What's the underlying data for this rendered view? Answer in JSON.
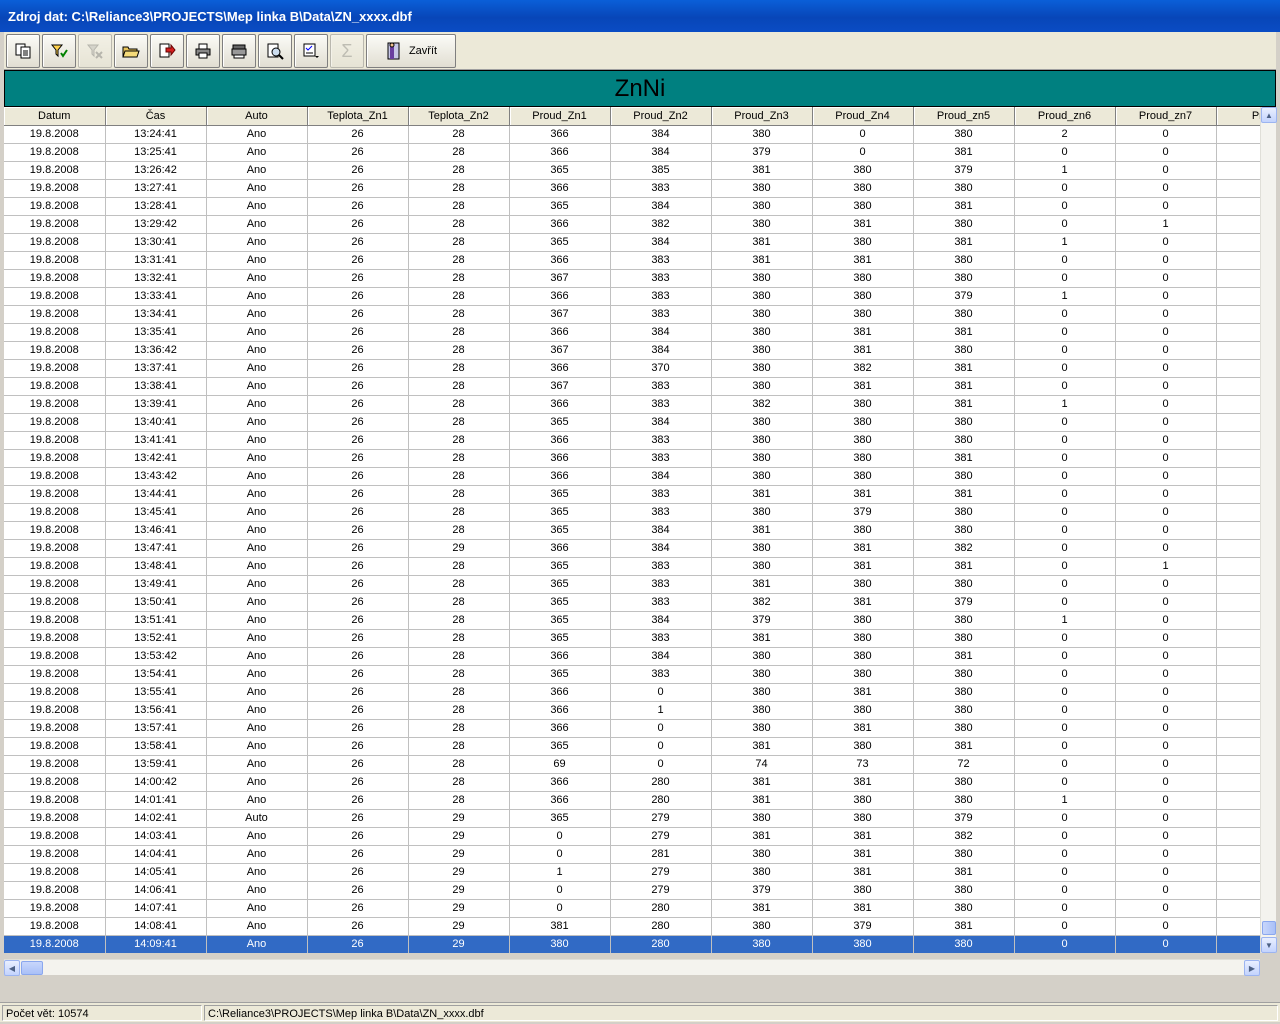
{
  "window": {
    "title": "Zdroj dat: C:\\Reliance3\\PROJECTS\\Mep linka B\\Data\\ZN_xxxx.dbf"
  },
  "toolbar": {
    "close_label": "Zavřít"
  },
  "banner": {
    "title": "ZnNi"
  },
  "table": {
    "columns": [
      "Datum",
      "Čas",
      "Auto",
      "Teplota_Zn1",
      "Teplota_Zn2",
      "Proud_Zn1",
      "Proud_Zn2",
      "Proud_Zn3",
      "Proud_Zn4",
      "Proud_zn5",
      "Proud_zn6",
      "Proud_zn7",
      "Proud"
    ],
    "selected_row": 45,
    "rows": [
      [
        "19.8.2008",
        "13:24:41",
        "Ano",
        "26",
        "28",
        "366",
        "384",
        "380",
        "0",
        "380",
        "2",
        "0",
        ""
      ],
      [
        "19.8.2008",
        "13:25:41",
        "Ano",
        "26",
        "28",
        "366",
        "384",
        "379",
        "0",
        "381",
        "0",
        "0",
        ""
      ],
      [
        "19.8.2008",
        "13:26:42",
        "Ano",
        "26",
        "28",
        "365",
        "385",
        "381",
        "380",
        "379",
        "1",
        "0",
        ""
      ],
      [
        "19.8.2008",
        "13:27:41",
        "Ano",
        "26",
        "28",
        "366",
        "383",
        "380",
        "380",
        "380",
        "0",
        "0",
        ""
      ],
      [
        "19.8.2008",
        "13:28:41",
        "Ano",
        "26",
        "28",
        "365",
        "384",
        "380",
        "380",
        "381",
        "0",
        "0",
        ""
      ],
      [
        "19.8.2008",
        "13:29:42",
        "Ano",
        "26",
        "28",
        "366",
        "382",
        "380",
        "381",
        "380",
        "0",
        "1",
        ""
      ],
      [
        "19.8.2008",
        "13:30:41",
        "Ano",
        "26",
        "28",
        "365",
        "384",
        "381",
        "380",
        "381",
        "1",
        "0",
        ""
      ],
      [
        "19.8.2008",
        "13:31:41",
        "Ano",
        "26",
        "28",
        "366",
        "383",
        "381",
        "381",
        "380",
        "0",
        "0",
        ""
      ],
      [
        "19.8.2008",
        "13:32:41",
        "Ano",
        "26",
        "28",
        "367",
        "383",
        "380",
        "380",
        "380",
        "0",
        "0",
        ""
      ],
      [
        "19.8.2008",
        "13:33:41",
        "Ano",
        "26",
        "28",
        "366",
        "383",
        "380",
        "380",
        "379",
        "1",
        "0",
        ""
      ],
      [
        "19.8.2008",
        "13:34:41",
        "Ano",
        "26",
        "28",
        "367",
        "383",
        "380",
        "380",
        "380",
        "0",
        "0",
        ""
      ],
      [
        "19.8.2008",
        "13:35:41",
        "Ano",
        "26",
        "28",
        "366",
        "384",
        "380",
        "381",
        "381",
        "0",
        "0",
        ""
      ],
      [
        "19.8.2008",
        "13:36:42",
        "Ano",
        "26",
        "28",
        "367",
        "384",
        "380",
        "381",
        "380",
        "0",
        "0",
        ""
      ],
      [
        "19.8.2008",
        "13:37:41",
        "Ano",
        "26",
        "28",
        "366",
        "370",
        "380",
        "382",
        "381",
        "0",
        "0",
        ""
      ],
      [
        "19.8.2008",
        "13:38:41",
        "Ano",
        "26",
        "28",
        "367",
        "383",
        "380",
        "381",
        "381",
        "0",
        "0",
        ""
      ],
      [
        "19.8.2008",
        "13:39:41",
        "Ano",
        "26",
        "28",
        "366",
        "383",
        "382",
        "380",
        "381",
        "1",
        "0",
        ""
      ],
      [
        "19.8.2008",
        "13:40:41",
        "Ano",
        "26",
        "28",
        "365",
        "384",
        "380",
        "380",
        "380",
        "0",
        "0",
        ""
      ],
      [
        "19.8.2008",
        "13:41:41",
        "Ano",
        "26",
        "28",
        "366",
        "383",
        "380",
        "380",
        "380",
        "0",
        "0",
        ""
      ],
      [
        "19.8.2008",
        "13:42:41",
        "Ano",
        "26",
        "28",
        "366",
        "383",
        "380",
        "380",
        "381",
        "0",
        "0",
        ""
      ],
      [
        "19.8.2008",
        "13:43:42",
        "Ano",
        "26",
        "28",
        "366",
        "384",
        "380",
        "380",
        "380",
        "0",
        "0",
        ""
      ],
      [
        "19.8.2008",
        "13:44:41",
        "Ano",
        "26",
        "28",
        "365",
        "383",
        "381",
        "381",
        "381",
        "0",
        "0",
        ""
      ],
      [
        "19.8.2008",
        "13:45:41",
        "Ano",
        "26",
        "28",
        "365",
        "383",
        "380",
        "379",
        "380",
        "0",
        "0",
        ""
      ],
      [
        "19.8.2008",
        "13:46:41",
        "Ano",
        "26",
        "28",
        "365",
        "384",
        "381",
        "380",
        "380",
        "0",
        "0",
        ""
      ],
      [
        "19.8.2008",
        "13:47:41",
        "Ano",
        "26",
        "29",
        "366",
        "384",
        "380",
        "381",
        "382",
        "0",
        "0",
        ""
      ],
      [
        "19.8.2008",
        "13:48:41",
        "Ano",
        "26",
        "28",
        "365",
        "383",
        "380",
        "381",
        "381",
        "0",
        "1",
        ""
      ],
      [
        "19.8.2008",
        "13:49:41",
        "Ano",
        "26",
        "28",
        "365",
        "383",
        "381",
        "380",
        "380",
        "0",
        "0",
        ""
      ],
      [
        "19.8.2008",
        "13:50:41",
        "Ano",
        "26",
        "28",
        "365",
        "383",
        "382",
        "381",
        "379",
        "0",
        "0",
        ""
      ],
      [
        "19.8.2008",
        "13:51:41",
        "Ano",
        "26",
        "28",
        "365",
        "384",
        "379",
        "380",
        "380",
        "1",
        "0",
        ""
      ],
      [
        "19.8.2008",
        "13:52:41",
        "Ano",
        "26",
        "28",
        "365",
        "383",
        "381",
        "380",
        "380",
        "0",
        "0",
        ""
      ],
      [
        "19.8.2008",
        "13:53:42",
        "Ano",
        "26",
        "28",
        "366",
        "384",
        "380",
        "380",
        "381",
        "0",
        "0",
        ""
      ],
      [
        "19.8.2008",
        "13:54:41",
        "Ano",
        "26",
        "28",
        "365",
        "383",
        "380",
        "380",
        "380",
        "0",
        "0",
        ""
      ],
      [
        "19.8.2008",
        "13:55:41",
        "Ano",
        "26",
        "28",
        "366",
        "0",
        "380",
        "381",
        "380",
        "0",
        "0",
        ""
      ],
      [
        "19.8.2008",
        "13:56:41",
        "Ano",
        "26",
        "28",
        "366",
        "1",
        "380",
        "380",
        "380",
        "0",
        "0",
        ""
      ],
      [
        "19.8.2008",
        "13:57:41",
        "Ano",
        "26",
        "28",
        "366",
        "0",
        "380",
        "381",
        "380",
        "0",
        "0",
        ""
      ],
      [
        "19.8.2008",
        "13:58:41",
        "Ano",
        "26",
        "28",
        "365",
        "0",
        "381",
        "380",
        "381",
        "0",
        "0",
        ""
      ],
      [
        "19.8.2008",
        "13:59:41",
        "Ano",
        "26",
        "28",
        "69",
        "0",
        "74",
        "73",
        "72",
        "0",
        "0",
        ""
      ],
      [
        "19.8.2008",
        "14:00:42",
        "Ano",
        "26",
        "28",
        "366",
        "280",
        "381",
        "381",
        "380",
        "0",
        "0",
        ""
      ],
      [
        "19.8.2008",
        "14:01:41",
        "Ano",
        "26",
        "28",
        "366",
        "280",
        "381",
        "380",
        "380",
        "1",
        "0",
        ""
      ],
      [
        "19.8.2008",
        "14:02:41",
        "Auto",
        "26",
        "29",
        "365",
        "279",
        "380",
        "380",
        "379",
        "0",
        "0",
        ""
      ],
      [
        "19.8.2008",
        "14:03:41",
        "Ano",
        "26",
        "29",
        "0",
        "279",
        "381",
        "381",
        "382",
        "0",
        "0",
        ""
      ],
      [
        "19.8.2008",
        "14:04:41",
        "Ano",
        "26",
        "29",
        "0",
        "281",
        "380",
        "381",
        "380",
        "0",
        "0",
        ""
      ],
      [
        "19.8.2008",
        "14:05:41",
        "Ano",
        "26",
        "29",
        "1",
        "279",
        "380",
        "381",
        "381",
        "0",
        "0",
        ""
      ],
      [
        "19.8.2008",
        "14:06:41",
        "Ano",
        "26",
        "29",
        "0",
        "279",
        "379",
        "380",
        "380",
        "0",
        "0",
        ""
      ],
      [
        "19.8.2008",
        "14:07:41",
        "Ano",
        "26",
        "29",
        "0",
        "280",
        "381",
        "381",
        "380",
        "0",
        "0",
        ""
      ],
      [
        "19.8.2008",
        "14:08:41",
        "Ano",
        "26",
        "29",
        "381",
        "280",
        "380",
        "379",
        "381",
        "0",
        "0",
        ""
      ],
      [
        "19.8.2008",
        "14:09:41",
        "Ano",
        "26",
        "29",
        "380",
        "280",
        "380",
        "380",
        "380",
        "0",
        "0",
        ""
      ]
    ]
  },
  "status": {
    "record_count": "Počet vět: 10574",
    "path": "C:\\Reliance3\\PROJECTS\\Mep linka B\\Data\\ZN_xxxx.dbf"
  },
  "colors": {
    "titlebar": "#0846b8",
    "banner": "#008080",
    "selection": "#316ac5"
  }
}
